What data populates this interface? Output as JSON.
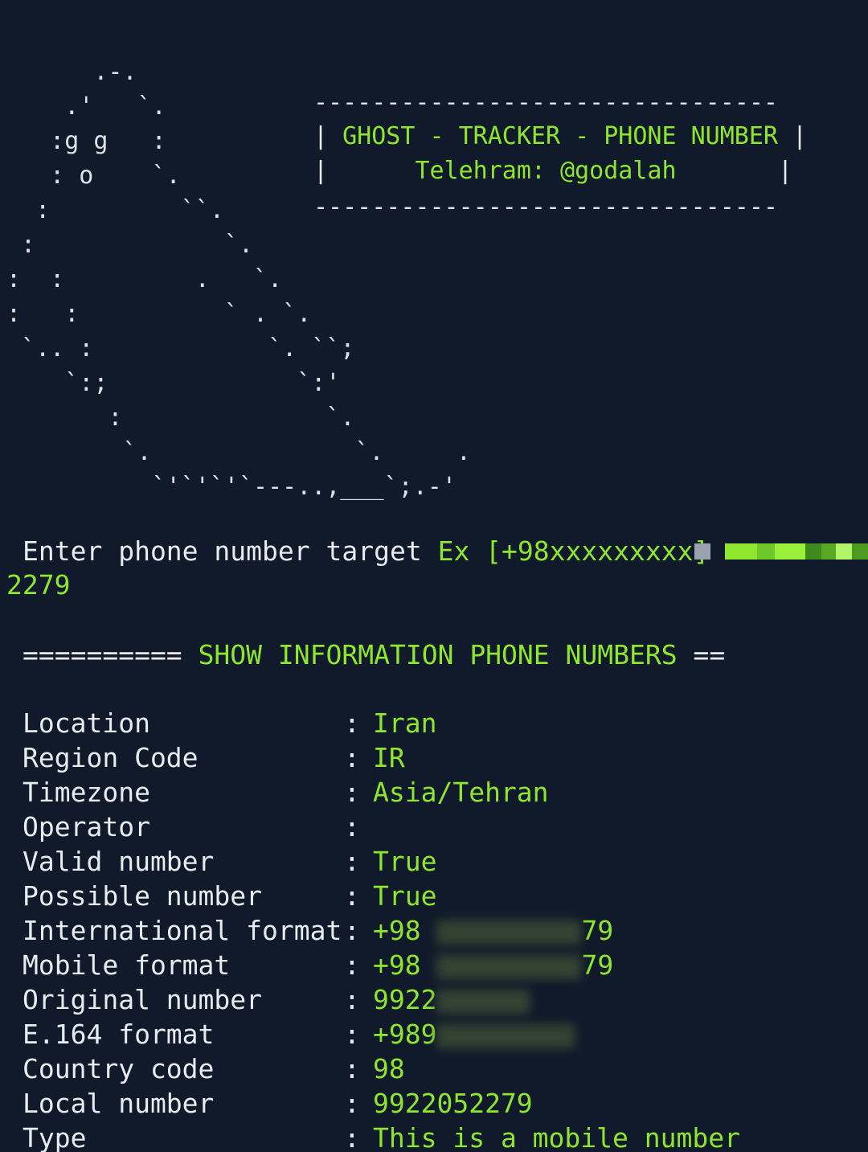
{
  "ascii_art": "      .-.\n    .'   `.\n   :g g   :\n   : o    `.\n  :         ``.\n :             `.\n:  :         .   `.\n:   :          ` . `.\n `.. :            `. ``;\n    `:;             `:'\n       :              `.\n        `.              `.     .\n          `'`'`'`---..,___`;.-'",
  "header_box": {
    "top_border": "--------------------------------",
    "title_prefix": "| ",
    "title": "GHOST - TRACKER - PHONE NUMBER",
    "title_suffix": " |",
    "subtitle_prefix": "|      ",
    "subtitle": "Telehram: @godalah",
    "subtitle_suffix": "       |",
    "bottom_border": "--------------------------------"
  },
  "prompt": {
    "label": "Enter phone number target",
    "example": "Ex [+98xxxxxxxxx]",
    "typed_value": "2279"
  },
  "section": {
    "prefix": "==========",
    "title": "SHOW INFORMATION PHONE NUMBERS",
    "suffix": "=="
  },
  "info": [
    {
      "label": "Location",
      "value": "Iran"
    },
    {
      "label": "Region Code",
      "value": "IR"
    },
    {
      "label": "Timezone",
      "value": "Asia/Tehran"
    },
    {
      "label": "Operator",
      "value": ""
    },
    {
      "label": "Valid number",
      "value": "True"
    },
    {
      "label": "Possible number",
      "value": "True"
    },
    {
      "label": "International format",
      "value": "+98",
      "redacted_tail": "79"
    },
    {
      "label": "Mobile format",
      "value": "+98",
      "redacted_tail": "79"
    },
    {
      "label": "Original number",
      "value": "9922"
    },
    {
      "label": "E.164 format",
      "value": "+989"
    },
    {
      "label": "Country code",
      "value": "98"
    },
    {
      "label": "Local number",
      "value": "9922052279"
    },
    {
      "label": "Type",
      "value": "This is a mobile number"
    }
  ],
  "colors": {
    "background": "#101a2a",
    "accent_green": "#8ee62e",
    "text_white": "#e8ecef"
  }
}
